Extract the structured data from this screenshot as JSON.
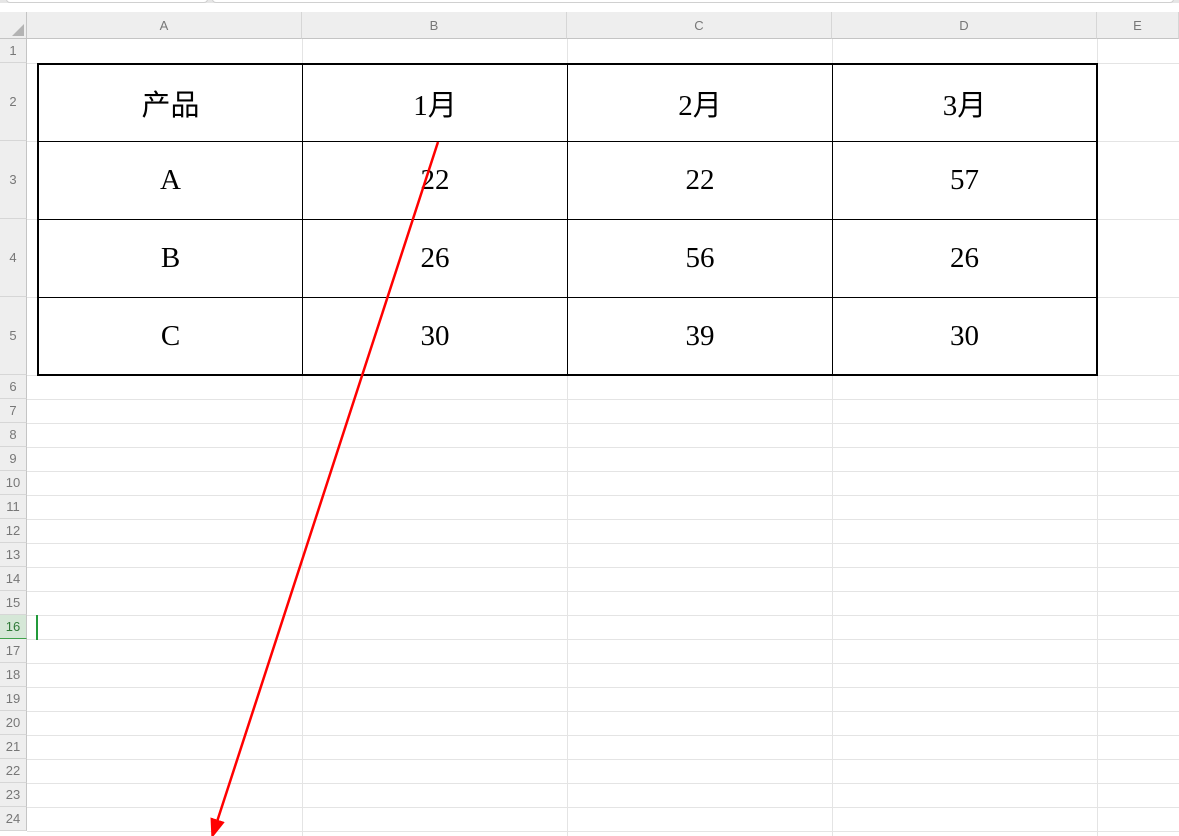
{
  "columns": [
    "A",
    "B",
    "C",
    "D",
    "E"
  ],
  "rows": [
    "1",
    "2",
    "3",
    "4",
    "5",
    "6",
    "7",
    "8",
    "9",
    "10",
    "11",
    "12",
    "13",
    "14",
    "15",
    "16",
    "17",
    "18",
    "19",
    "20",
    "21",
    "22",
    "23",
    "24"
  ],
  "selected_row_index": 15,
  "table": {
    "headers": [
      "产品",
      "1月",
      "2月",
      "3月"
    ],
    "rows": [
      {
        "product": "A",
        "m1": "22",
        "m2": "22",
        "m3": "57"
      },
      {
        "product": "B",
        "m1": "26",
        "m2": "56",
        "m3": "26"
      },
      {
        "product": "C",
        "m1": "30",
        "m2": "39",
        "m3": "30"
      }
    ]
  },
  "chart_data": {
    "type": "table",
    "categories": [
      "1月",
      "2月",
      "3月"
    ],
    "series": [
      {
        "name": "A",
        "values": [
          22,
          22,
          57
        ]
      },
      {
        "name": "B",
        "values": [
          26,
          56,
          26
        ]
      },
      {
        "name": "C",
        "values": [
          30,
          39,
          30
        ]
      }
    ],
    "title": "",
    "xlabel": "月",
    "ylabel": "产品"
  }
}
